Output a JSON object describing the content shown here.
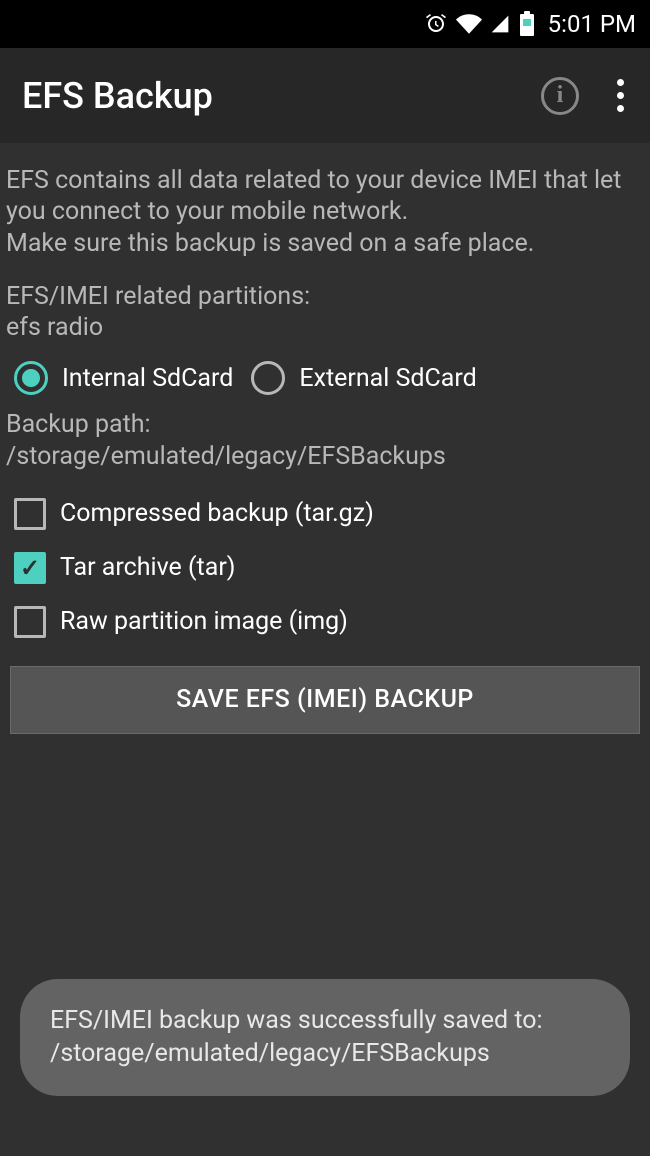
{
  "status_bar": {
    "time": "5:01 PM"
  },
  "header": {
    "title": "EFS Backup"
  },
  "content": {
    "description": "EFS contains all data related to your device IMEI that let you connect to your mobile network.\nMake sure this backup is saved on a safe place.",
    "partitions_label": "EFS/IMEI related partitions:",
    "partitions_value": "efs radio",
    "storage_options": {
      "internal": "Internal SdCard",
      "external": "External SdCard",
      "selected": "internal"
    },
    "path_label": "Backup path:",
    "path_value": "/storage/emulated/legacy/EFSBackups",
    "formats": {
      "compressed": {
        "label": "Compressed backup (tar.gz)",
        "checked": false
      },
      "tar": {
        "label": "Tar archive (tar)",
        "checked": true
      },
      "raw": {
        "label": "Raw partition image (img)",
        "checked": false
      }
    },
    "save_button": "SAVE EFS (IMEI) BACKUP"
  },
  "toast": {
    "line1": "EFS/IMEI backup was successfully saved to:",
    "line2": "/storage/emulated/legacy/EFSBackups"
  }
}
